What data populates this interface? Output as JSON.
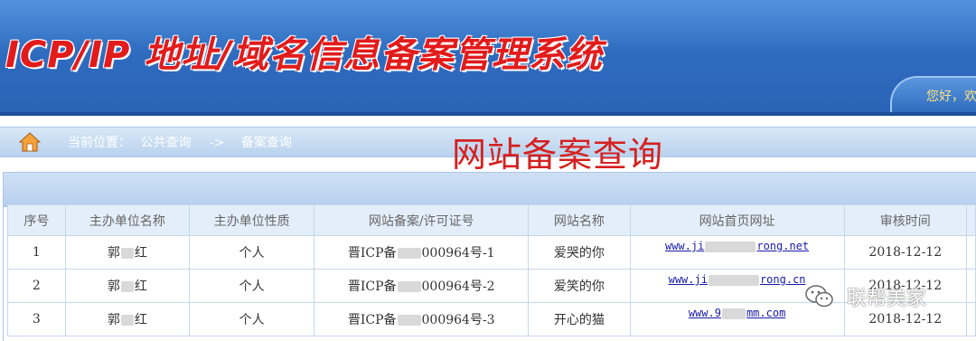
{
  "header": {
    "title": "ICP/IP 地址/域名信息备案管理系统",
    "greeting": "您好，欢"
  },
  "breadcrumb": {
    "label": "当前位置：",
    "items": [
      "公共查询",
      "->",
      "备案查询"
    ]
  },
  "page_heading": "网站备案查询",
  "table": {
    "columns": [
      "序号",
      "主办单位名称",
      "主办单位性质",
      "网站备案/许可证号",
      "网站名称",
      "网站首页网址",
      "审核时间"
    ],
    "rows": [
      {
        "index": "1",
        "org_a": "郭",
        "org_b": "红",
        "nature": "个人",
        "license_a": "晋ICP备",
        "license_b": "000964号-1",
        "site_name": "爱哭的你",
        "url_a": "www.ji",
        "url_b": "rong.net",
        "date": "2018-12-12"
      },
      {
        "index": "2",
        "org_a": "郭",
        "org_b": "红",
        "nature": "个人",
        "license_a": "晋ICP备",
        "license_b": "000964号-2",
        "site_name": "爱笑的你",
        "url_a": "www.ji",
        "url_b": "rong.cn",
        "date": "2018-12-12"
      },
      {
        "index": "3",
        "org_a": "郭",
        "org_b": "红",
        "nature": "个人",
        "license_a": "晋ICP备",
        "license_b": "000964号-3",
        "site_name": "开心的猫",
        "url_a": "www.9",
        "url_b": "mm.com",
        "date": "2018-12-12"
      }
    ]
  },
  "watermark": "联帮美家",
  "colors": {
    "banner": "#2f6cc0",
    "title_red": "#e21b1b",
    "heading_red": "#d62020",
    "link": "#1a1aa8"
  }
}
